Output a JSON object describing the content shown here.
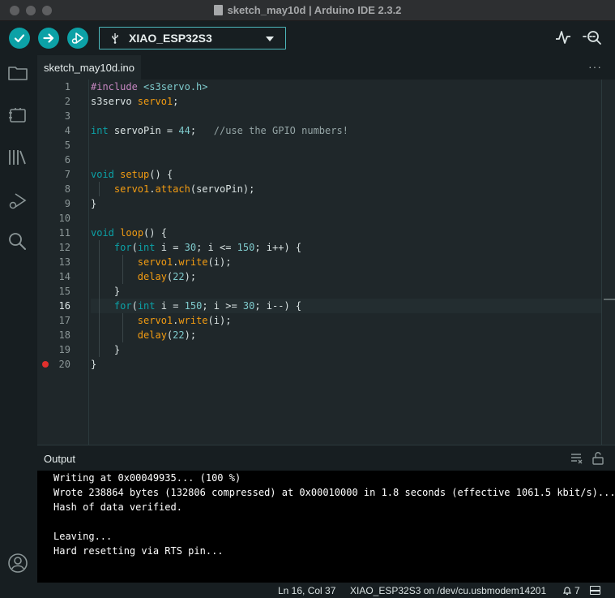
{
  "window": {
    "title": "sketch_may10d | Arduino IDE 2.3.2"
  },
  "toolbar": {
    "verify_icon": "check-icon",
    "upload_icon": "arrow-right-icon",
    "debug_icon": "debug-play-icon",
    "board_icon": "usb-icon",
    "board_name": "XIAO_ESP32S3",
    "serial_plotter_icon": "pulse-icon",
    "serial_monitor_icon": "magnifier-dots-icon"
  },
  "sidebar": {
    "items": [
      {
        "name": "sketchbook",
        "icon": "folder-icon"
      },
      {
        "name": "boards-manager",
        "icon": "board-icon"
      },
      {
        "name": "library-manager",
        "icon": "library-icon"
      },
      {
        "name": "debug",
        "icon": "debug-icon"
      },
      {
        "name": "search",
        "icon": "search-icon"
      }
    ],
    "account_icon": "account-icon"
  },
  "tabs": [
    {
      "label": "sketch_may10d.ino"
    }
  ],
  "tab_more": "···",
  "editor": {
    "active_line": 16,
    "breakpoint_line": 20,
    "line_numbers": [
      "1",
      "2",
      "3",
      "4",
      "5",
      "6",
      "7",
      "8",
      "9",
      "10",
      "11",
      "12",
      "13",
      "14",
      "15",
      "16",
      "17",
      "18",
      "19",
      "20"
    ],
    "lines": [
      "#include <s3servo.h>",
      "s3servo servo1;",
      "",
      "int servoPin = 44;   //use the GPIO numbers!",
      "",
      "",
      "void setup() {",
      "    servo1.attach(servoPin);",
      "}",
      "",
      "void loop() {",
      "    for(int i = 30; i <= 150; i++) {",
      "        servo1.write(i);",
      "        delay(22);",
      "    }",
      "    for(int i = 150; i >= 30; i--) {",
      "        servo1.write(i);",
      "        delay(22);",
      "    }",
      "}"
    ]
  },
  "output": {
    "title": "Output",
    "clear_icon": "clear-list-icon",
    "lock_icon": "unlock-icon",
    "lines": [
      "Writing at 0x00049935... (100 %)",
      "Wrote 238864 bytes (132806 compressed) at 0x00010000 in 1.8 seconds (effective 1061.5 kbit/s)...",
      "Hash of data verified.",
      "",
      "Leaving...",
      "Hard resetting via RTS pin..."
    ]
  },
  "status": {
    "position": "Ln 16, Col 37",
    "board_port": "XIAO_ESP32S3 on /dev/cu.usbmodem14201",
    "notifications": "7",
    "notification_icon": "bell-icon",
    "panel_icon": "panel-toggle-icon"
  }
}
